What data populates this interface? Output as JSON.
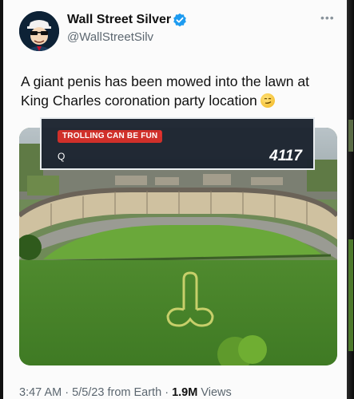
{
  "tweet": {
    "display_name": "Wall Street Silver",
    "handle": "@WallStreetSilv",
    "text": "A giant penis has been mowed into the lawn at King Charles coronation party location",
    "time": "3:47 AM",
    "date": "5/5/23",
    "source": "from Earth",
    "views_count": "1.9M",
    "views_label": "Views",
    "separator": "·"
  },
  "overlay": {
    "badge": "TROLLING CAN BE FUN",
    "bang": "!",
    "query": "Q",
    "count": "4117"
  },
  "icons": {
    "verified": "verified-badge-icon",
    "more": "more-icon",
    "emoji": "smirk-emoji-icon"
  },
  "colors": {
    "verified_blue": "#1d9bf0",
    "badge_red": "#d0302a",
    "overlay_bg": "#1c2430"
  }
}
